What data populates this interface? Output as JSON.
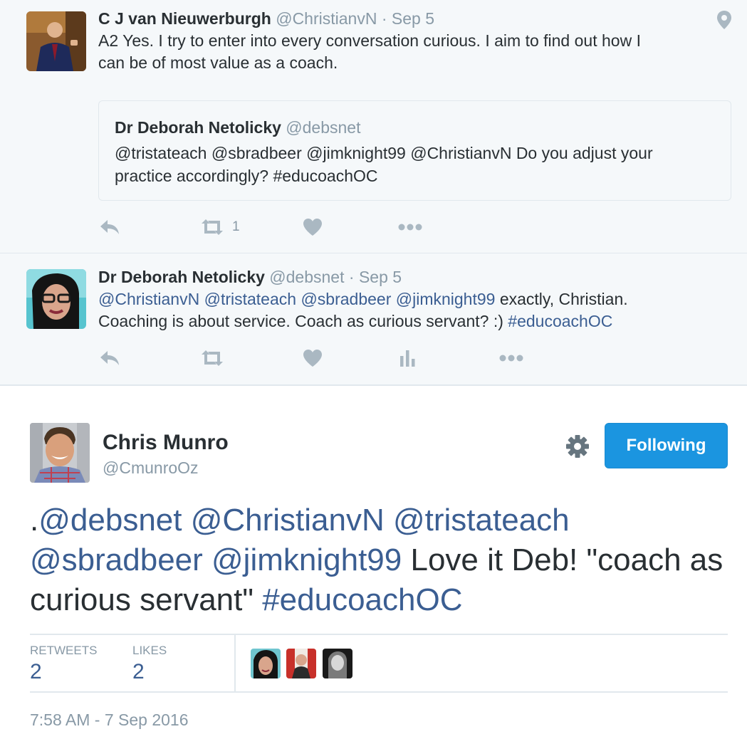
{
  "tweet1": {
    "name": "C J van Nieuwerburgh",
    "handle": "@ChristianvN",
    "separator": "·",
    "date": "Sep 5",
    "text_line1": "A2 Yes. I try to enter into every conversation curious. I aim to find out how I",
    "text_line2": "can be of most value as a coach.",
    "location_icon": "location-pin-icon",
    "quote": {
      "name": "Dr Deborah Netolicky",
      "handle": "@debsnet",
      "text": "@tristateach @sbradbeer @jimknight99 @ChristianvN Do you adjust your practice accordingly? #educoachOC"
    },
    "actions": {
      "reply_icon": "reply-icon",
      "retweet_icon": "retweet-icon",
      "retweet_count": "1",
      "like_icon": "heart-icon",
      "more_icon": "more-icon"
    }
  },
  "tweet2": {
    "name": "Dr Deborah Netolicky",
    "handle": "@debsnet",
    "separator": "·",
    "date": "Sep 5",
    "mentions_line1": "@ChristianvN @tristateach @sbradbeer @jimknight99",
    "text_line1_rest": " exactly, Christian.",
    "text_line2": "Coaching is about service. Coach as curious servant? :) ",
    "hashtag": "#educoachOC",
    "actions": {
      "reply_icon": "reply-icon",
      "retweet_icon": "retweet-icon",
      "like_icon": "heart-icon",
      "analytics_icon": "analytics-icon",
      "more_icon": "more-icon"
    }
  },
  "main_tweet": {
    "name": "Chris Munro",
    "handle": "@CmunroOz",
    "follow_label": "Following",
    "settings_icon": "gear-icon",
    "text_prefix": ".",
    "mentions_a": "@debsnet @ChristianvN @tristateach",
    "mentions_b": "@sbradbeer @jimknight99",
    "text_mid": " Love it Deb! \"coach as curious servant\" ",
    "hashtag": "#educoachOC",
    "stats": {
      "retweets_label": "RETWEETS",
      "retweets": "2",
      "likes_label": "LIKES",
      "likes": "2"
    },
    "timestamp": "7:58 AM - 7 Sep 2016"
  },
  "colors": {
    "link": "#3b5e92",
    "muted": "#8899a6",
    "text": "#292f33",
    "follow_button": "#1b95e0",
    "grey_background": "#f5f8fa"
  }
}
